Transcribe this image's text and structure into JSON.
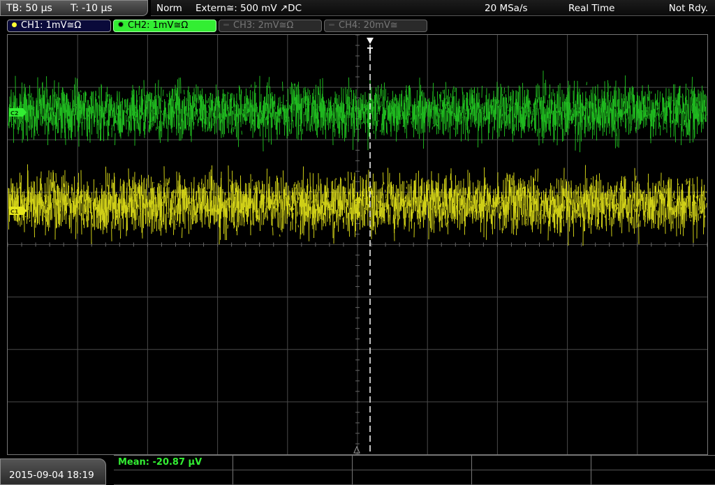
{
  "topbar": {
    "timebase": "TB: 50 µs",
    "trigger_offset": "T: -10 µs",
    "trigger_mode": "Norm",
    "trigger_source": "Extern≅: 500 mV ↗DC",
    "sample_rate": "20 MSa/s",
    "acquisition": "Real Time",
    "run_state": "Not Rdy."
  },
  "channels": [
    {
      "label": "CH1: 1mV≅Ω",
      "color": "#ffff33",
      "active": true
    },
    {
      "label": "CH2: 1mV≅Ω",
      "color": "#33ee33",
      "active": true,
      "selected": true
    },
    {
      "label": "CH3: 2mV≅Ω",
      "color": "#777777",
      "active": false
    },
    {
      "label": "CH4: 20mV≅",
      "color": "#777777",
      "active": false
    }
  ],
  "markers": {
    "trigger_marker": "T",
    "ch2_marker": "C2",
    "ch1_marker": "C1"
  },
  "footer": {
    "datetime": "2015-09-04 18:19",
    "measurement": "Mean: -20.87 µV"
  },
  "colors": {
    "ch1": "#e6e61a",
    "ch2": "#22cc22",
    "grid": "#4a4a4a",
    "accent": "#33ee33"
  }
}
